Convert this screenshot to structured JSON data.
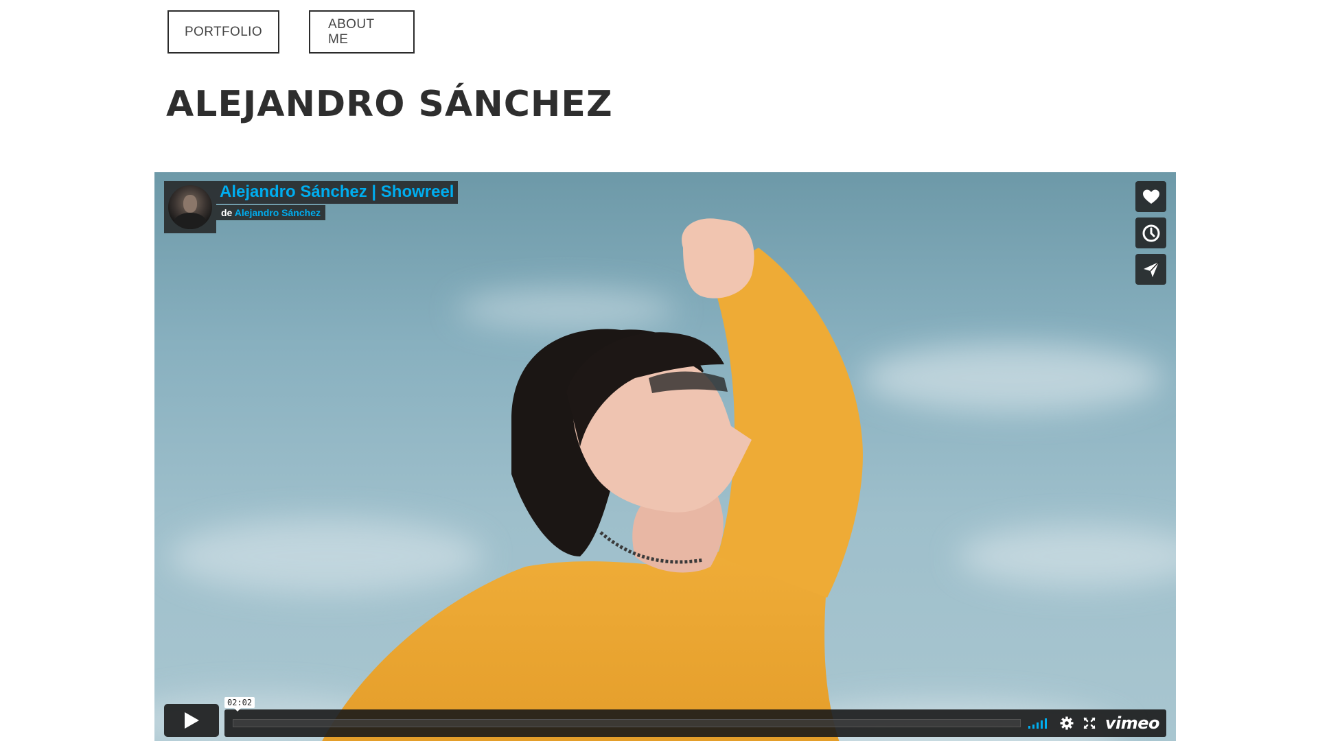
{
  "nav": {
    "portfolio_label": "PORTFOLIO",
    "about_label": "ABOUT ME"
  },
  "page": {
    "title": "ALEJANDRO SÁNCHEZ"
  },
  "video": {
    "title": "Alejandro Sánchez | Showreel",
    "by_prefix": "de",
    "author": "Alejandro Sánchez",
    "duration": "02:02",
    "progress": 0,
    "accent_color": "#00adef",
    "side_actions": [
      "heart-icon",
      "clock-icon",
      "send-icon"
    ],
    "controls": [
      "play-icon",
      "volume-icon",
      "gear-icon",
      "fullscreen-icon"
    ],
    "logo_text": "vimeo"
  }
}
